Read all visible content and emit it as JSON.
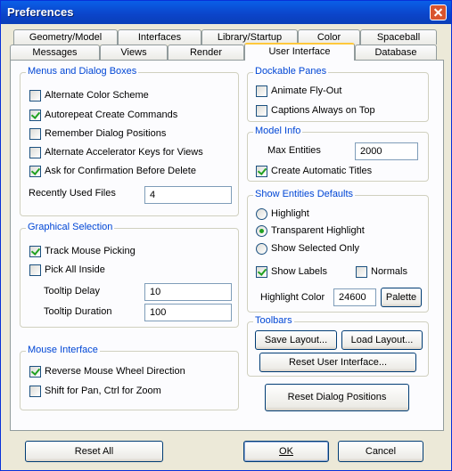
{
  "window": {
    "title": "Preferences"
  },
  "tabs": {
    "row1": [
      "Geometry/Model",
      "Interfaces",
      "Library/Startup",
      "Color",
      "Spaceball"
    ],
    "row2": [
      "Messages",
      "Views",
      "Render",
      "User Interface",
      "Database"
    ],
    "active": "User Interface"
  },
  "menus": {
    "title": "Menus and Dialog Boxes",
    "alternate_color": {
      "label": "Alternate Color Scheme",
      "checked": false
    },
    "autorepeat": {
      "label": "Autorepeat Create Commands",
      "checked": true
    },
    "remember_positions": {
      "label": "Remember Dialog Positions",
      "checked": false
    },
    "alt_accel": {
      "label": "Alternate Accelerator Keys for Views",
      "checked": false
    },
    "confirm_delete": {
      "label": "Ask for Confirmation Before Delete",
      "checked": true
    },
    "recent_label": "Recently Used Files",
    "recent_value": "4"
  },
  "graphical": {
    "title": "Graphical Selection",
    "track_mouse": {
      "label": "Track Mouse Picking",
      "checked": true
    },
    "pick_all": {
      "label": "Pick All Inside",
      "checked": false
    },
    "tooltip_delay_label": "Tooltip Delay",
    "tooltip_delay_value": "10",
    "tooltip_duration_label": "Tooltip Duration",
    "tooltip_duration_value": "100"
  },
  "mouse": {
    "title": "Mouse Interface",
    "reverse_wheel": {
      "label": "Reverse Mouse Wheel Direction",
      "checked": true
    },
    "shift_pan": {
      "label": "Shift for Pan, Ctrl for Zoom",
      "checked": false
    }
  },
  "dockable": {
    "title": "Dockable Panes",
    "animate": {
      "label": "Animate Fly-Out",
      "checked": false
    },
    "captions": {
      "label": "Captions Always on Top",
      "checked": false
    }
  },
  "model_info": {
    "title": "Model Info",
    "max_label": "Max Entities",
    "max_value": "2000",
    "auto_titles": {
      "label": "Create Automatic Titles",
      "checked": true
    }
  },
  "show_entities": {
    "title": "Show Entities Defaults",
    "highlight": {
      "label": "Highlight",
      "selected": false
    },
    "transparent": {
      "label": "Transparent Highlight",
      "selected": true
    },
    "selected_only": {
      "label": "Show Selected Only",
      "selected": false
    },
    "show_labels": {
      "label": "Show Labels",
      "checked": true
    },
    "normals": {
      "label": "Normals",
      "checked": false
    },
    "highlight_color_label": "Highlight Color",
    "highlight_color_value": "24600",
    "palette_label": "Palette"
  },
  "toolbars": {
    "title": "Toolbars",
    "save_layout": "Save Layout...",
    "load_layout": "Load Layout...",
    "reset_ui": "Reset User Interface..."
  },
  "reset_dialog_positions": "Reset Dialog Positions",
  "footer": {
    "reset_all": "Reset All",
    "ok": "OK",
    "cancel": "Cancel"
  },
  "colors": {
    "title_bar": "#0b44c9",
    "group_title": "#0046d5",
    "check": "#21a121",
    "active_tab_accent": "#ffc83c"
  }
}
